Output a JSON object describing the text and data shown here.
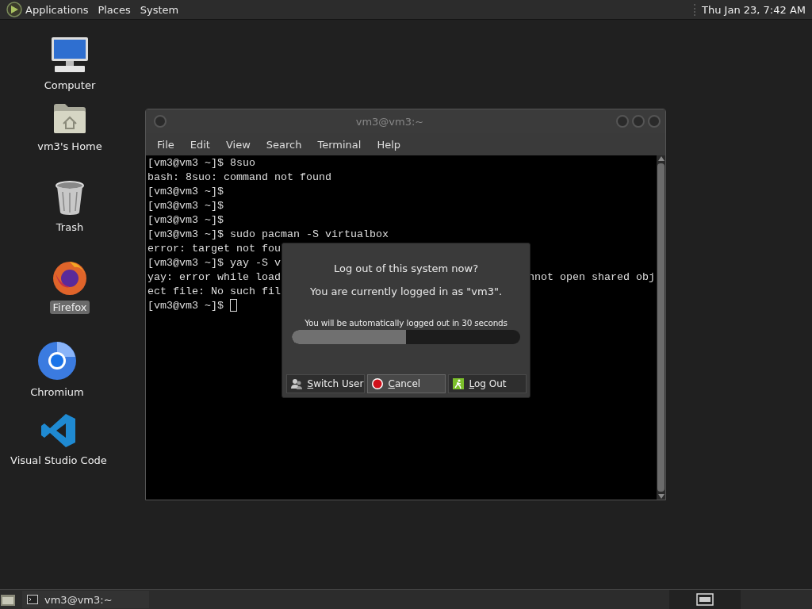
{
  "top_panel": {
    "menus": [
      "Applications",
      "Places",
      "System"
    ],
    "clock": "Thu Jan 23,  7:42 AM"
  },
  "desktop_icons": [
    {
      "kind": "computer",
      "label": "Computer",
      "selected": false
    },
    {
      "kind": "home",
      "label": "vm3's Home",
      "selected": false
    },
    {
      "kind": "trash",
      "label": "Trash",
      "selected": false
    },
    {
      "kind": "firefox",
      "label": "Firefox",
      "selected": true
    },
    {
      "kind": "chromium",
      "label": "Chromium",
      "selected": false
    },
    {
      "kind": "vscode",
      "label": "Visual Studio Code",
      "selected": false
    }
  ],
  "terminal_window": {
    "title": "vm3@vm3:~",
    "menu": [
      "File",
      "Edit",
      "View",
      "Search",
      "Terminal",
      "Help"
    ],
    "lines": [
      {
        "text": "[vm3@vm3 ~]$ 8suo"
      },
      {
        "text": "bash: 8suo: command not found"
      },
      {
        "text": "[vm3@vm3 ~]$"
      },
      {
        "text": "[vm3@vm3 ~]$"
      },
      {
        "text": "[vm3@vm3 ~]$"
      },
      {
        "text": "[vm3@vm3 ~]$ sudo pacman -S virtualbox"
      },
      {
        "text": "error: target not fou"
      },
      {
        "text": "[vm3@vm3 ~]$ yay -S v"
      },
      {
        "text": "yay: error while load",
        "tail": "nnot open shared obj"
      },
      {
        "text": "ect file: No such fil"
      },
      {
        "text": "[vm3@vm3 ~]$ ",
        "cursor": true
      }
    ]
  },
  "logout_dialog": {
    "question": "Log out of this system now?",
    "info": "You are currently logged in as \"vm3\".",
    "countdown": "You will be automatically logged out in 30 seconds",
    "level": 0.5,
    "buttons": [
      {
        "kind": "switch-user",
        "label": "Switch User",
        "mnemonic": true,
        "selected": false
      },
      {
        "kind": "cancel",
        "label": "Cancel",
        "mnemonic": true,
        "selected": true
      },
      {
        "kind": "log-out",
        "label": "Log Out",
        "mnemonic": true,
        "selected": false
      }
    ]
  },
  "bottom_panel": {
    "tasks": [
      {
        "label": "vm3@vm3:~",
        "selected": false
      }
    ]
  }
}
